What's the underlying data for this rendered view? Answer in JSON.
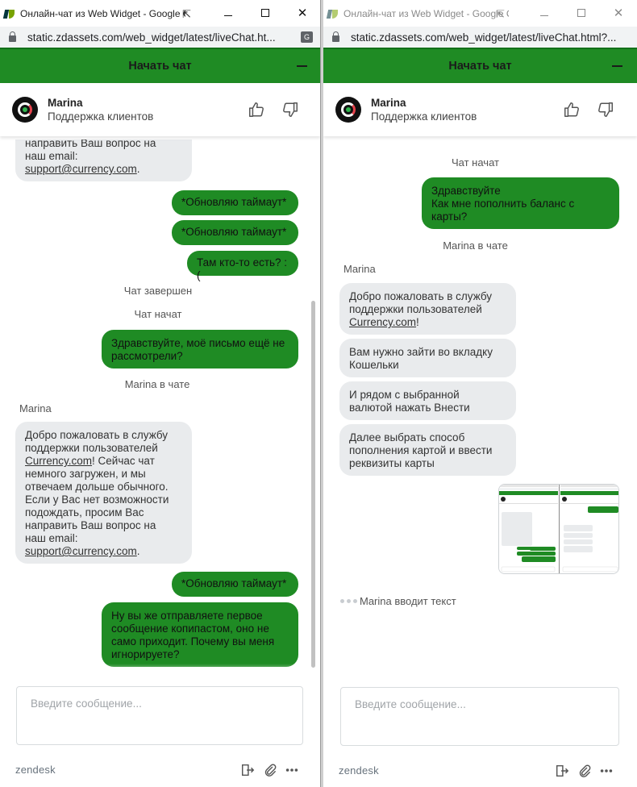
{
  "left": {
    "title": "Онлайн-чат из Web Widget - Google Chro...",
    "url": "static.zdassets.com/web_widget/latest/liveChat.ht...",
    "header": "Начать чат",
    "agent": {
      "name": "Marina",
      "role": "Поддержка клиентов"
    },
    "top_bubble": {
      "line1": "направить Ваш вопрос на",
      "line2": "наш email:",
      "link": "support@currency.com",
      "after": "."
    },
    "user_msgs_1": [
      "*Обновляю таймаут*",
      "*Обновляю таймаут*",
      "Там кто-то есть? :("
    ],
    "sys_chat_ended": "Чат завершен",
    "sys_chat_started": "Чат начат",
    "user_msg_2": {
      "line1": "Здравствуйте, моё письмо ещё не",
      "line2": "рассмотрели?"
    },
    "sys_agent_joined": "Marina в чате",
    "sender": "Marina",
    "welcome": {
      "line1": "Добро пожаловать в службу",
      "line2": "поддержки пользователей",
      "link1": "Currency.com",
      "l3rest": "! Сейчас чат",
      "line4": "немного загружен, и мы",
      "line5": "отвечаем дольше обычного.",
      "line6": "Если у Вас нет возможности",
      "line7": "подождать, просим Вас",
      "line8": "направить Ваш вопрос на",
      "line9": "наш email:",
      "link2": "support@currency.com",
      "l10rest": "."
    },
    "user_msg_3": "*Обновляю таймаут*",
    "user_msg_4": {
      "line1": "Ну вы же отправляете первое",
      "line2": "сообщение копипастом, оно не",
      "line3": "само приходит. Почему вы меня",
      "line4": "игнорируете?"
    },
    "composer_placeholder": "Введите сообщение...",
    "brand": "zendesk"
  },
  "right": {
    "title": "Онлайн-чат из Web Widget - Google Ch...",
    "url": "static.zdassets.com/web_widget/latest/liveChat.html?...",
    "header": "Начать чат",
    "agent": {
      "name": "Marina",
      "role": "Поддержка клиентов"
    },
    "sys_chat_started": "Чат начат",
    "user_msg_1": {
      "line1": "Здравствуйте",
      "line2": "Как мне пополнить баланс с",
      "line3": "карты?"
    },
    "sys_agent_joined": "Marina в чате",
    "sender": "Marina",
    "agent_msg_1": {
      "line1": "Добро пожаловать в службу",
      "line2": "поддержки пользователей",
      "link": "Currency.com",
      "after": "!"
    },
    "agent_msg_2": {
      "line1": "Вам нужно зайти во вкладку",
      "line2": "Кошельки"
    },
    "agent_msg_3": {
      "line1": "И рядом с выбранной",
      "line2": "валютой нажать Внести"
    },
    "agent_msg_4": {
      "line1": "Далее выбрать способ",
      "line2": "пополнения картой и ввести",
      "line3": "реквизиты карты"
    },
    "typing": "Marina вводит текст",
    "composer_placeholder": "Введите сообщение...",
    "brand": "zendesk"
  },
  "colors": {
    "brand_green": "#1f8b24",
    "agent_bubble": "#e9ebed"
  }
}
